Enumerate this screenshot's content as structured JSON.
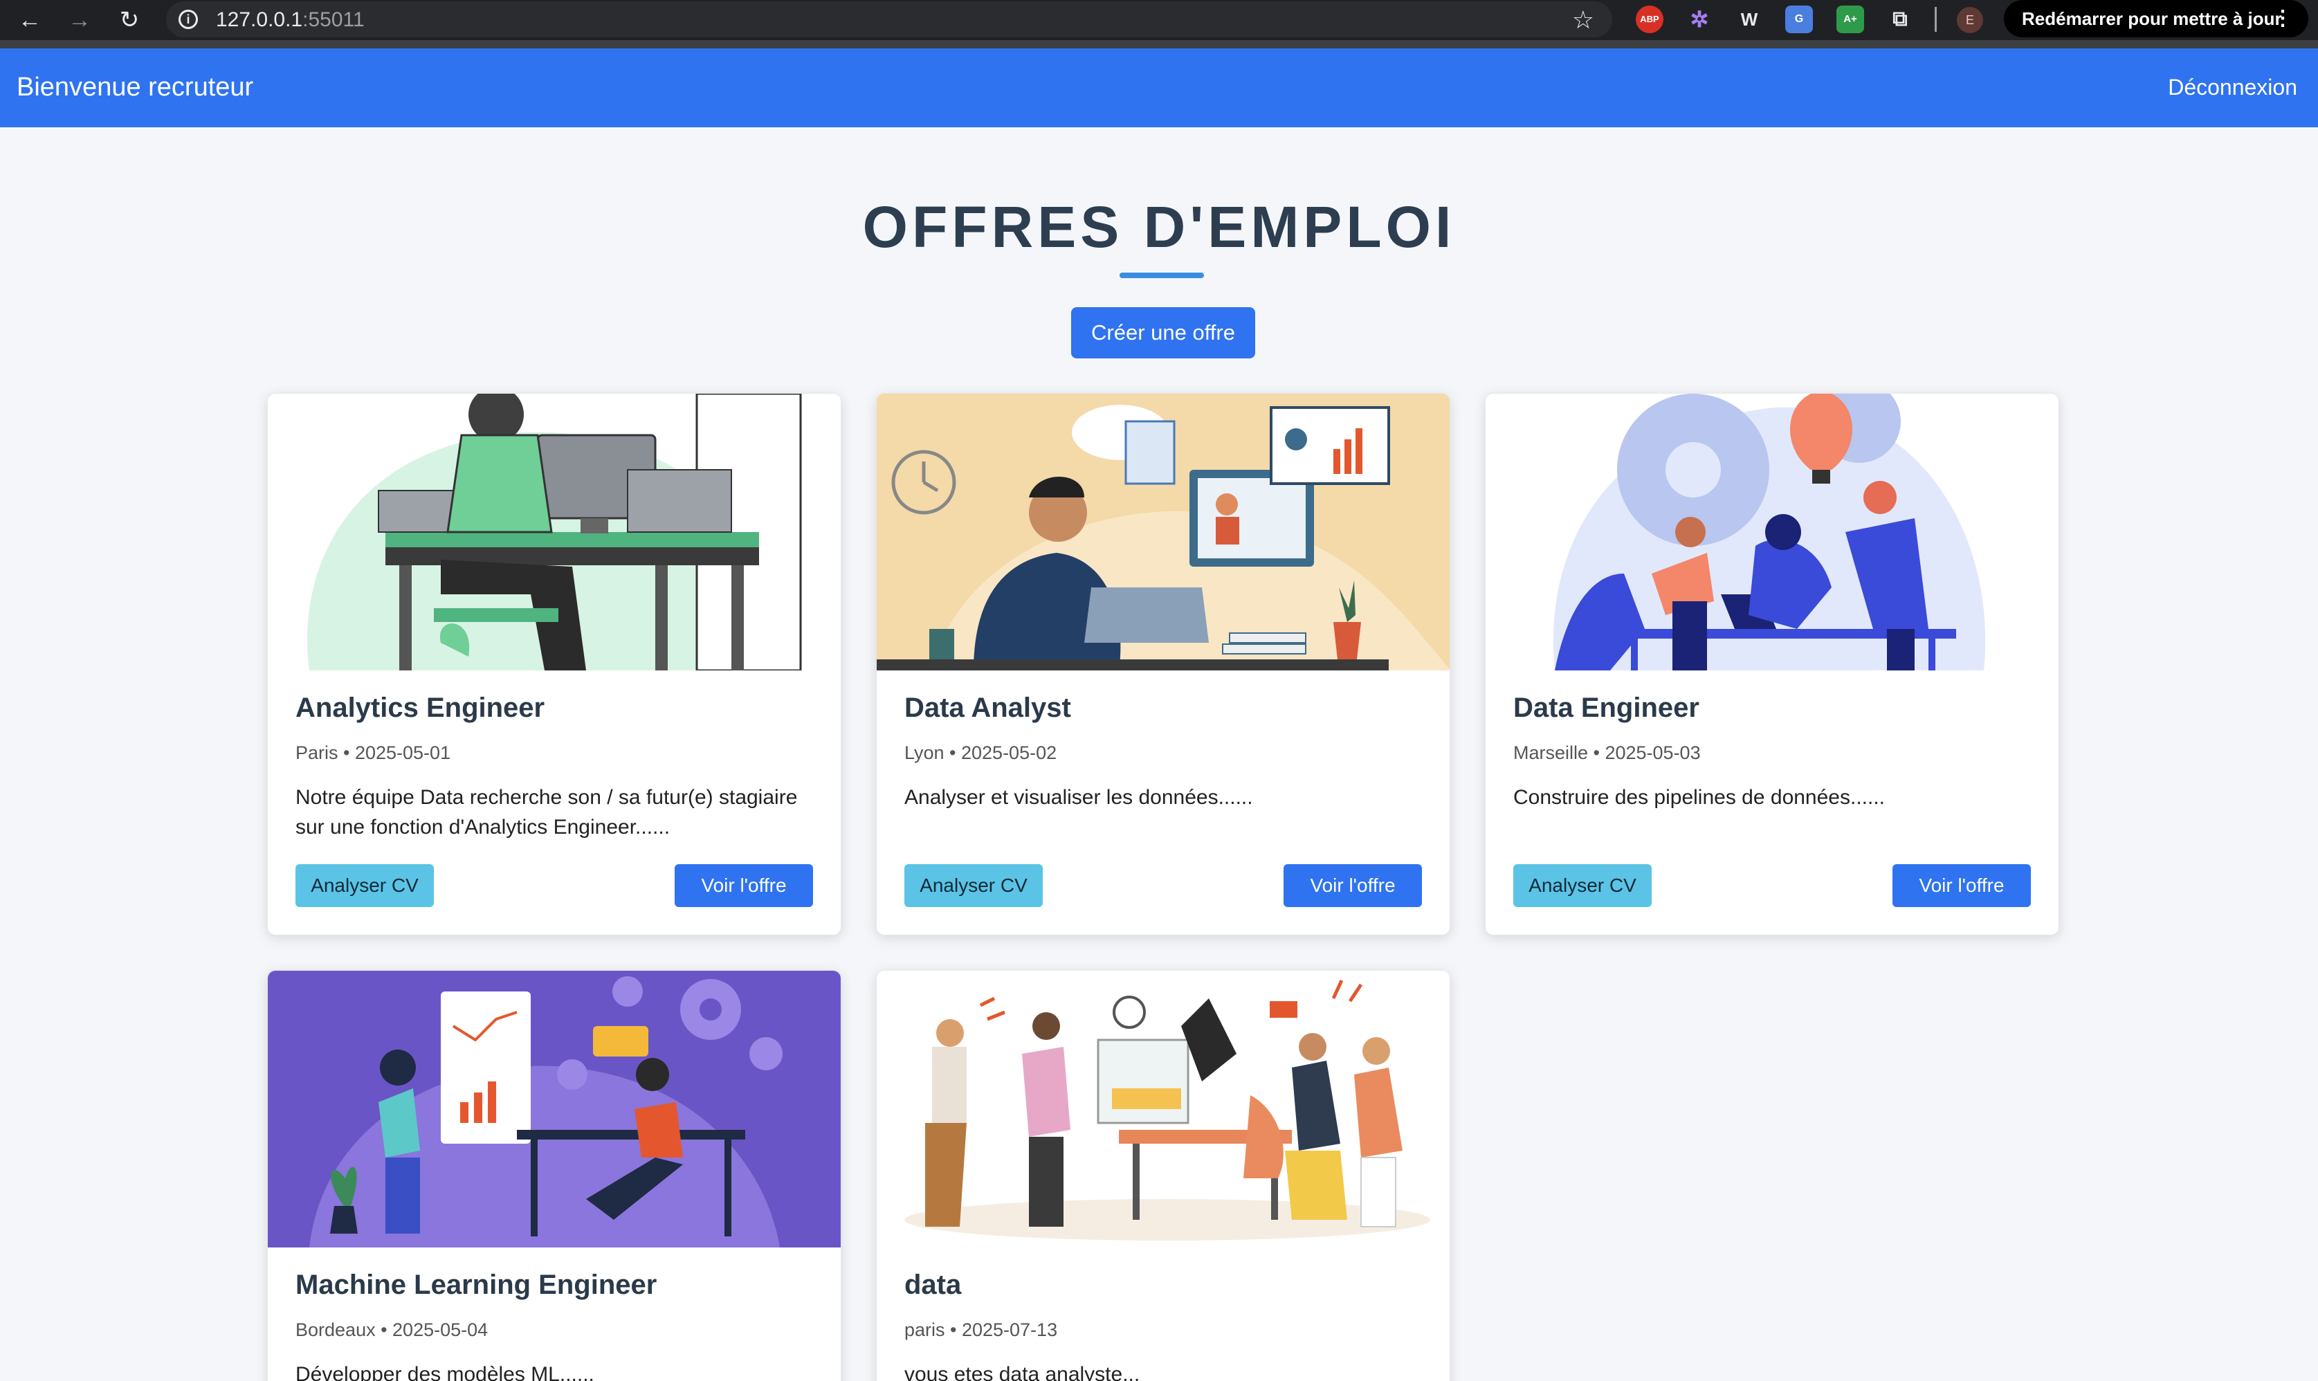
{
  "browser": {
    "url_host": "127.0.0.1",
    "url_port": ":55011",
    "update_label": "Redémarrer pour mettre à jour",
    "profile_initial": "E",
    "extensions": [
      "ABP",
      "✲",
      "W",
      "G",
      "A+",
      "⧉"
    ]
  },
  "header": {
    "title": "Bienvenue recruteur",
    "logout_label": "Déconnexion"
  },
  "main": {
    "title": "OFFRES D'EMPLOI",
    "create_label": "Créer une offre",
    "analyze_label": "Analyser CV",
    "view_label": "Voir l'offre",
    "jobs": [
      {
        "title": "Analytics Engineer",
        "meta": "Paris • 2025-05-01",
        "desc": "Notre équipe Data recherche son / sa futur(e) stagiaire sur une fonction d'Analytics Engineer......"
      },
      {
        "title": "Data Analyst",
        "meta": "Lyon • 2025-05-02",
        "desc": "Analyser et visualiser les données......"
      },
      {
        "title": "Data Engineer",
        "meta": "Marseille • 2025-05-03",
        "desc": "Construire des pipelines de données......"
      },
      {
        "title": "Machine Learning Engineer",
        "meta": "Bordeaux • 2025-05-04",
        "desc": "Développer des modèles ML......"
      },
      {
        "title": "data",
        "meta": "paris • 2025-07-13",
        "desc": "vous etes data analyste..."
      }
    ]
  },
  "colors": {
    "primary": "#2f73f0",
    "info": "#5bc3e6",
    "heading": "#2d3e50"
  }
}
